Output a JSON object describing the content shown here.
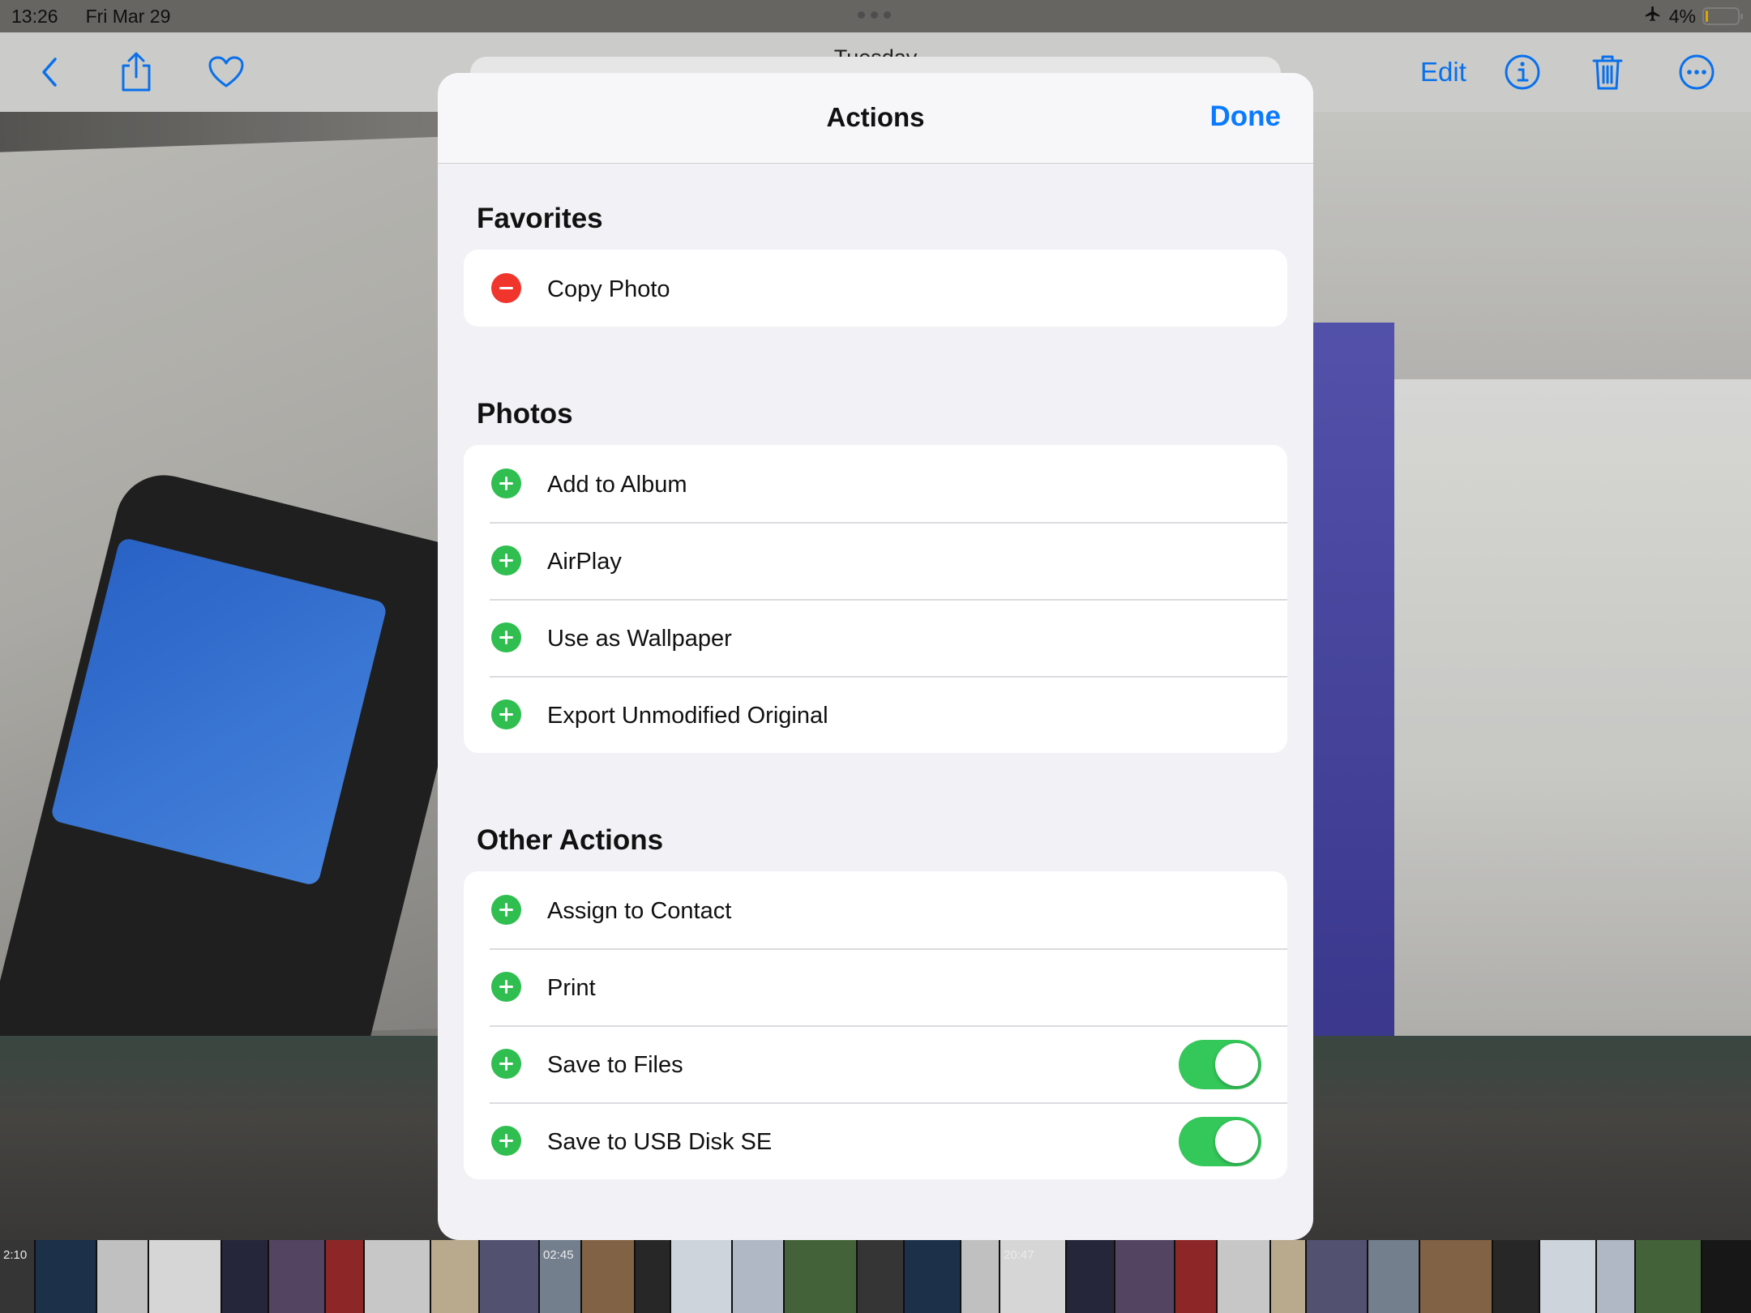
{
  "status_bar": {
    "time": "13:26",
    "date": "Fri Mar 29",
    "battery": "4%",
    "battery_level": 0.04,
    "airplane_icon": "airplane-icon"
  },
  "nav": {
    "date_title": "Tuesday",
    "edit_label": "Edit",
    "icons": [
      "back-chevron-icon",
      "share-icon",
      "heart-icon",
      "info-icon",
      "trash-icon",
      "more-icon"
    ]
  },
  "modal": {
    "title": "Actions",
    "done_label": "Done",
    "sections": [
      {
        "title": "Favorites",
        "items": [
          {
            "label": "Copy Photo",
            "action": "remove"
          }
        ]
      },
      {
        "title": "Photos",
        "items": [
          {
            "label": "Add to Album",
            "action": "add"
          },
          {
            "label": "AirPlay",
            "action": "add"
          },
          {
            "label": "Use as Wallpaper",
            "action": "add"
          },
          {
            "label": "Export Unmodified Original",
            "action": "add"
          }
        ]
      },
      {
        "title": "Other Actions",
        "items": [
          {
            "label": "Assign to Contact",
            "action": "add"
          },
          {
            "label": "Print",
            "action": "add"
          },
          {
            "label": "Save to Files",
            "action": "add",
            "toggle": true
          },
          {
            "label": "Save to USB Disk SE",
            "action": "add",
            "toggle": true
          }
        ]
      }
    ]
  },
  "thumbnails": {
    "times": [
      "2:10",
      "02:45",
      "20:47"
    ]
  },
  "colors": {
    "accent": "#0a7aff",
    "add": "#2fbe4f",
    "remove": "#f0352c",
    "toggle_on": "#34c759"
  }
}
